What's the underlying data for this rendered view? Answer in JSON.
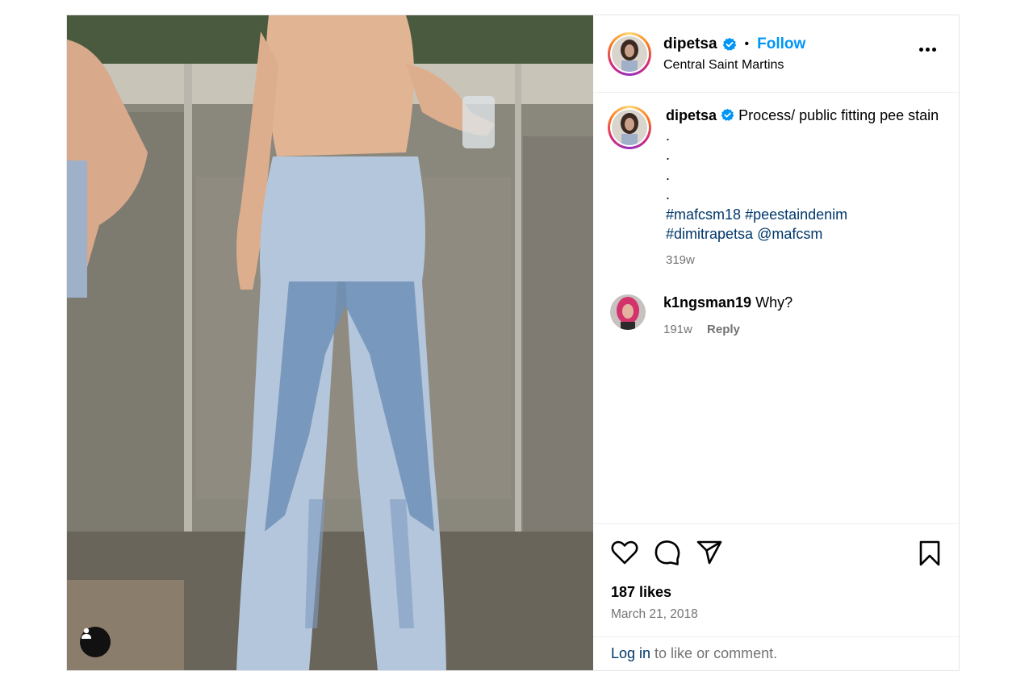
{
  "post": {
    "author": {
      "username": "dipetsa",
      "location": "Central Saint Martins",
      "follow_label": "Follow",
      "separator": "•"
    },
    "caption": {
      "username": "dipetsa",
      "text": "Process/ public fitting pee stain .",
      "dots": [
        ".",
        ".",
        "."
      ],
      "hashtags": [
        "#mafcsm18",
        "#peestaindenim",
        "#dimitrapetsa",
        "@mafcsm"
      ],
      "time": "319w"
    },
    "comments": [
      {
        "username": "k1ngsman19",
        "text": "Why?",
        "time": "191w",
        "reply_label": "Reply"
      }
    ],
    "likes": "187 likes",
    "date": "March 21, 2018",
    "login_prompt": {
      "link": "Log in",
      "rest": "to like or comment."
    }
  },
  "colors": {
    "link_blue": "#0095f6",
    "hashtag": "#00376b",
    "muted": "#737373",
    "verified": "#0095f6"
  },
  "icons": [
    "verified-badge-icon",
    "more-options-icon",
    "heart-icon",
    "comment-icon",
    "share-icon",
    "bookmark-icon",
    "user-tag-icon"
  ]
}
